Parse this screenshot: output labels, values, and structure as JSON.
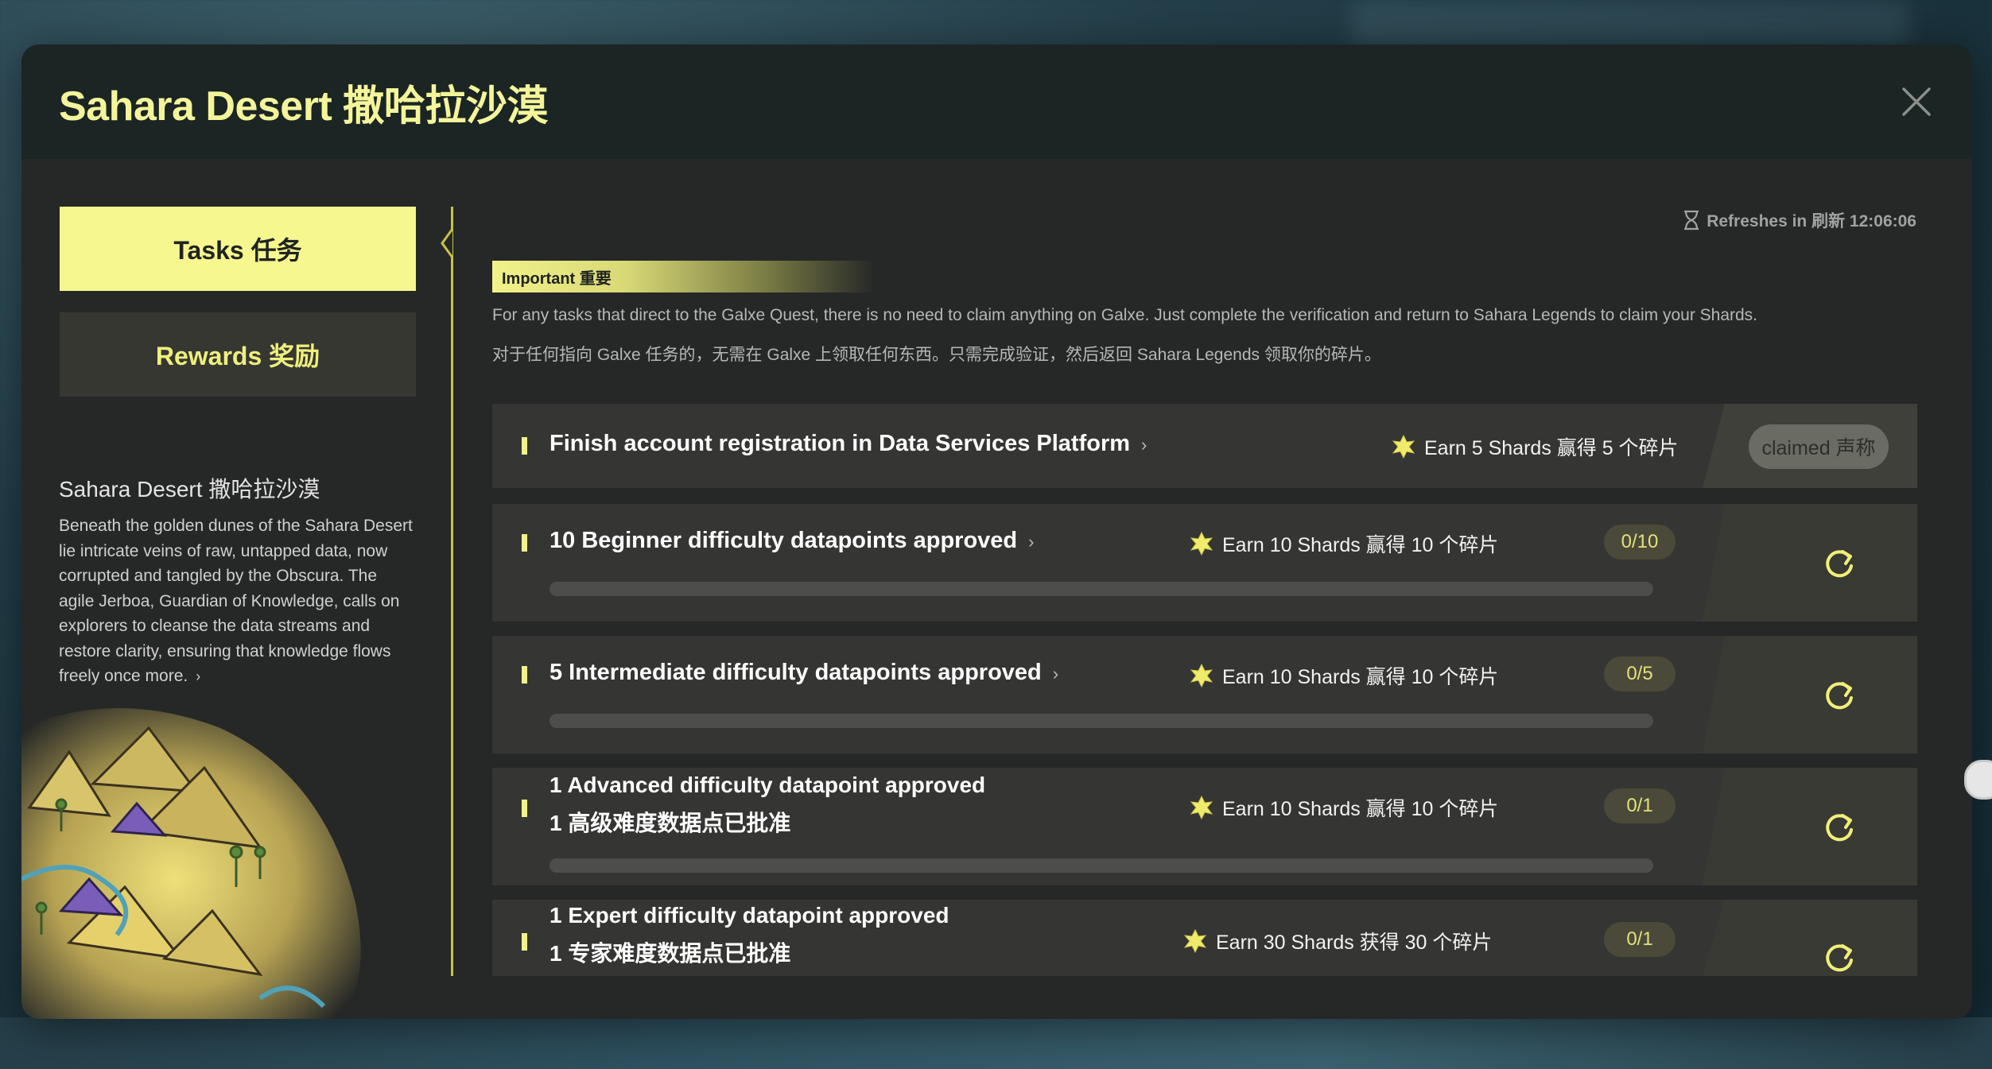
{
  "modal": {
    "title": "Sahara Desert  撒哈拉沙漠",
    "close_icon": "close-icon"
  },
  "tabs": {
    "tasks_label": "Tasks  任务",
    "rewards_label": "Rewards  奖励"
  },
  "region": {
    "title": "Sahara Desert 撒哈拉沙漠",
    "description": "Beneath the golden dunes of the Sahara Desert lie intricate veins of raw, untapped data, now corrupted and tangled by the Obscura. The agile Jerboa, Guardian of Knowledge, calls on explorers to cleanse the data streams and restore clarity, ensuring that knowledge flows freely once more.",
    "more_icon": "chevron-right-icon"
  },
  "refresh": {
    "text": "Refreshes in  刷新 12:06:06",
    "icon": "hourglass-icon"
  },
  "notice": {
    "label": "Important  重要",
    "text_en": "For any tasks that direct to the Galxe Quest, there is no need to claim anything on Galxe. Just complete the verification and return to Sahara Legends to claim your Shards.",
    "text_cn": "对于任何指向 Galxe 任务的，无需在 Galxe 上领取任何东西。只需完成验证，然后返回 Sahara Legends 领取你的碎片。"
  },
  "tasks": [
    {
      "title": "Finish account registration in Data Services Platform",
      "reward": "Earn 5 Shards  赢得 5 个碎片",
      "status": "claimed  声称"
    },
    {
      "title": "10 Beginner difficulty datapoints approved",
      "reward": "Earn 10 Shards  赢得 10 个碎片",
      "progress": "0/10",
      "progress_fraction": 0
    },
    {
      "title": "5 Intermediate difficulty datapoints approved",
      "reward": "Earn 10 Shards  赢得 10 个碎片",
      "progress": "0/5",
      "progress_fraction": 0
    },
    {
      "title": "1 Advanced difficulty datapoint approved",
      "subtitle": "1 高级难度数据点已批准",
      "reward": "Earn 10 Shards  赢得 10 个碎片",
      "progress": "0/1",
      "progress_fraction": 0
    },
    {
      "title": "1 Expert difficulty datapoint approved",
      "subtitle": "1 专家难度数据点已批准",
      "reward": "Earn 30 Shards  获得 30 个碎片",
      "progress": "0/1",
      "progress_fraction": 0
    }
  ],
  "icons": {
    "shard": "shard-icon",
    "refresh": "refresh-icon"
  },
  "colors": {
    "accent": "#f4f59a",
    "tab_active": "#f7f78f",
    "panel": "#262827",
    "row": "#353533"
  }
}
